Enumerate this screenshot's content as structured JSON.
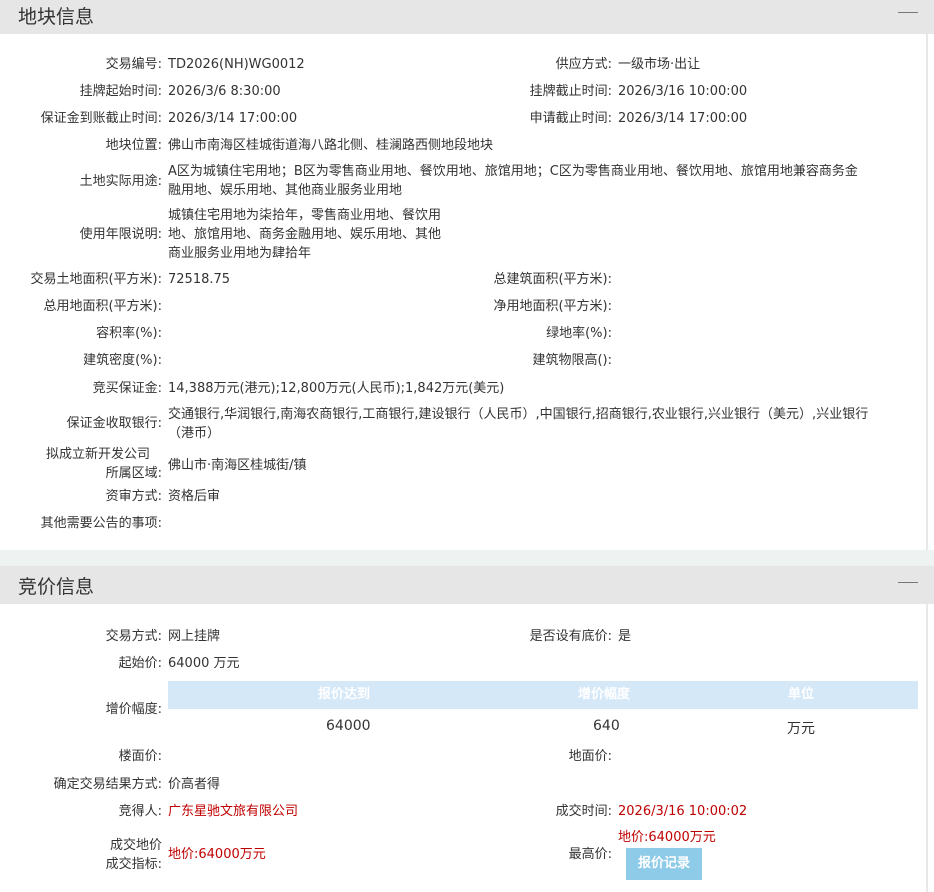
{
  "section1": {
    "title": "地块信息",
    "fields": {
      "trade_no_label": "交易编号:",
      "trade_no": "TD2026(NH)WG0012",
      "supply_label": "供应方式:",
      "supply": "一级市场·出让",
      "list_start_label": "挂牌起始时间:",
      "list_start": "2026/3/6 8:30:00",
      "list_end_label": "挂牌截止时间:",
      "list_end": "2026/3/16 10:00:00",
      "deposit_deadline_label": "保证金到账截止时间:",
      "deposit_deadline": "2026/3/14 17:00:00",
      "apply_deadline_label": "申请截止时间:",
      "apply_deadline": "2026/3/14 17:00:00",
      "location_label": "地块位置:",
      "location": "佛山市南海区桂城街道海八路北侧、桂澜路西侧地段地块",
      "usage_label": "土地实际用途:",
      "usage_line1": "A区为城镇住宅用地；B区为零售商业用地、餐饮用地、旅馆用地；C区为零售商业用地、餐饮用地、旅馆用地兼容商务金",
      "usage_line2": "融用地、娱乐用地、其他商业服务业用地",
      "term_label": "使用年限说明:",
      "term_line1": "城镇住宅用地为柒拾年，零售商业用地、餐饮用",
      "term_line2": "地、旅馆用地、商务金融用地、娱乐用地、其他",
      "term_line3": "商业服务业用地为肆拾年",
      "land_area_label": "交易土地面积(平方米):",
      "land_area": "72518.75",
      "build_area_label": "总建筑面积(平方米):",
      "build_area": "",
      "total_use_label": "总用地面积(平方米):",
      "total_use": "",
      "net_use_label": "净用地面积(平方米):",
      "net_use": "",
      "far_label": "容积率(%):",
      "far": "",
      "green_label": "绿地率(%):",
      "green": "",
      "density_label": "建筑密度(%):",
      "density": "",
      "height_label": "建筑物限高():",
      "height": "",
      "bond_label": "竞买保证金:",
      "bond": "14,388万元(港元);12,800万元(人民币);1,842万元(美元)",
      "banks_label": "保证金收取银行:",
      "banks_line1": "交通银行,华润银行,南海农商银行,工商银行,建设银行（人民币）,中国银行,招商银行,农业银行,兴业银行（美元）,兴业银行",
      "banks_line2": "（港币）",
      "newco_label_line1": "拟成立新开发公司",
      "newco_label_line2": "所属区域:",
      "newco": "佛山市·南海区桂城街/镇",
      "review_label": "资审方式:",
      "review": "资格后审",
      "other_label": "其他需要公告的事项:",
      "other": ""
    }
  },
  "section2": {
    "title": "竞价信息",
    "fields": {
      "mode_label": "交易方式:",
      "mode": "网上挂牌",
      "reserve_label": "是否设有底价:",
      "reserve": "是",
      "start_price_label": "起始价:",
      "start_price": "64000 万元",
      "increment_label": "增价幅度:",
      "floor_price_label": "楼面价:",
      "floor_price": "",
      "land_price_label": "地面价:",
      "land_price": "",
      "result_label": "确定交易结果方式:",
      "result": "价高者得",
      "winner_label": "竞得人:",
      "winner": "广东星驰文旅有限公司",
      "deal_time_label": "成交时间:",
      "deal_time": "2026/3/16 10:00:02",
      "deal_price_label_line1": "成交地价",
      "deal_price_label_line2": "成交指标:",
      "deal_price": "地价:64000万元",
      "max_price_label": "最高价:",
      "max_price": "地价:64000万元",
      "bid_record_button": "报价记录"
    },
    "increment_table": {
      "headers": [
        "报价达到",
        "增价幅度",
        "单位"
      ],
      "row": [
        "64000",
        "640",
        "万元"
      ]
    }
  },
  "colors": {
    "header_bg": "#e6e6e6",
    "table_head_bg": "#d5e8f8",
    "accent_red": "#c00000",
    "button_bg": "#8ecbe8"
  }
}
